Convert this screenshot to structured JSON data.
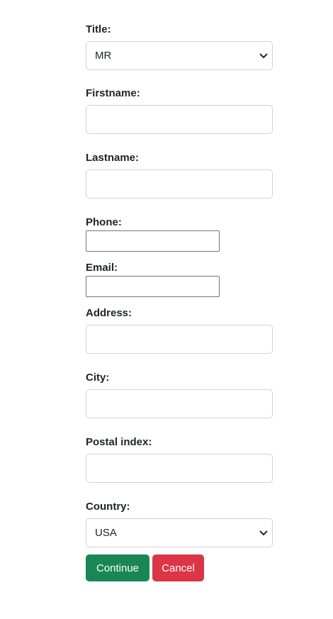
{
  "form": {
    "title_label": "Title:",
    "title_value": "MR",
    "firstname_label": "Firstname:",
    "firstname_value": "",
    "lastname_label": "Lastname:",
    "lastname_value": "",
    "phone_label": "Phone:",
    "phone_value": "",
    "email_label": "Email:",
    "email_value": "",
    "address_label": "Address:",
    "address_value": "",
    "city_label": "City:",
    "city_value": "",
    "postal_label": "Postal index:",
    "postal_value": "",
    "country_label": "Country:",
    "country_value": "USA"
  },
  "buttons": {
    "continue_label": "Continue",
    "cancel_label": "Cancel"
  },
  "colors": {
    "continue": "#198754",
    "cancel": "#dc3545"
  }
}
